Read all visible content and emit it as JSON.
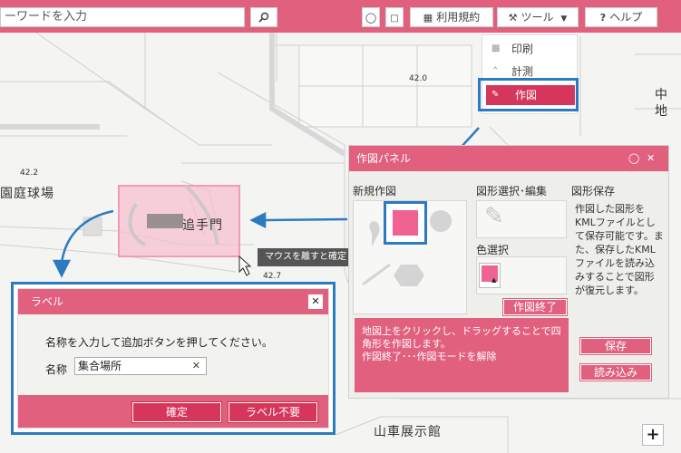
{
  "toolbar": {
    "search_value": "ーワードを入力",
    "search_icon": "magnifier",
    "terms_label": "利用規約",
    "tools_label": "ツール",
    "help_label": "ヘルプ"
  },
  "tool_menu": {
    "items": [
      {
        "label": "印刷",
        "icon": "print-icon"
      },
      {
        "label": "計測",
        "icon": "ruler-icon"
      },
      {
        "label": "作図",
        "icon": "pencil-icon"
      }
    ]
  },
  "map": {
    "elevations": [
      "42.0",
      "42.2",
      "42.7"
    ],
    "place_labels": {
      "garden": "園庭球場",
      "gate": "追手門",
      "hall": "山車展示館",
      "edge_top": "中",
      "edge_bottom": "地"
    },
    "zoom_in": "+"
  },
  "tooltip": {
    "text": "マウスを離すと確定"
  },
  "draw_panel": {
    "title": "作図パネル",
    "new_section": "新規作図",
    "select_section": "図形選択･編集",
    "save_section": "図形保存",
    "color_section": "色選択",
    "end_button": "作図終了",
    "save_description": "作図した図形を\nKMLファイルとして保存可能です。また、保存したKMLファイルを読み込みすることで図形が復元します。",
    "save_button": "保存",
    "load_button": "読み込み",
    "message": "地図上をクリックし、ドラッグすることで四角形を作図します。\n作図終了･･･作図モードを解除",
    "selected_color": "#f06292"
  },
  "label_dialog": {
    "title": "ラベル",
    "instruction": "名称を入力して追加ボタンを押してください。",
    "name_label": "名称",
    "name_value": "集合場所",
    "confirm_button": "確定",
    "no_label_button": "ラベル不要"
  },
  "colors": {
    "accent": "#e0607e",
    "accent_dark": "#d6365c",
    "highlight": "#2c7bbf"
  }
}
